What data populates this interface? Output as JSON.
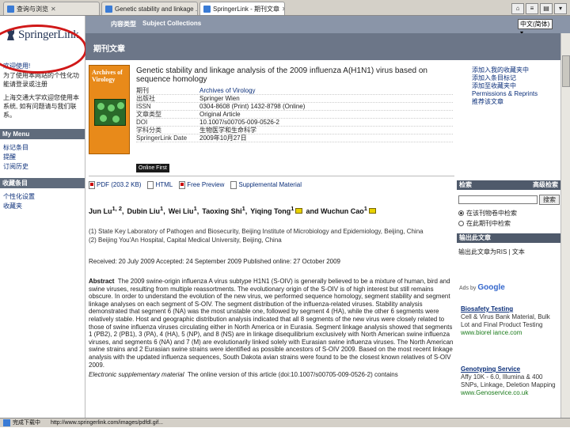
{
  "tabs": [
    {
      "label": "查询与浏览",
      "active": false
    },
    {
      "label": "Genetic stability and linkage ...",
      "active": false
    },
    {
      "label": "SpringerLink - 期刊文章",
      "active": true
    }
  ],
  "logo": {
    "text": "SpringerLink",
    "highlight_color": "#d01818"
  },
  "left": {
    "link1": "欢迎使用!",
    "text1": "为了使用本网站的个性化功能请登录或注册",
    "text2": "上海交通大学欢迎您使用本系统, 如有问题请与我们联系。",
    "my_menu": "My Menu",
    "menu_items": [
      "标记条目",
      "提醒",
      "订阅历史"
    ],
    "collections": "收藏条目",
    "collection_items": [
      "个性化设置",
      "收藏夹"
    ]
  },
  "topbar": {
    "content_label": "内容类型",
    "subject_label": "Subject Collections",
    "language": "中文(简体)"
  },
  "subbar": {
    "title": "期刊文章"
  },
  "cover": {
    "title": "Archives of Virology"
  },
  "article": {
    "title": "Genetic stability and linkage analysis of the 2009 influenza A(H1N1) virus based on sequence homology",
    "meta": [
      {
        "k": "期刊",
        "v": "Archives of Virology",
        "link": true
      },
      {
        "k": "出版社",
        "v": "Springer Wien",
        "link": false
      },
      {
        "k": "ISSN",
        "v": "0304-8608 (Print) 1432-8798 (Online)",
        "link": false
      },
      {
        "k": "文章类型",
        "v": "Original Article",
        "link": false
      },
      {
        "k": "DOI",
        "v": "10.1007/s00705-009-0526-2",
        "link": false
      },
      {
        "k": "学科分类",
        "v": "生物医学和生命科学",
        "link": false
      },
      {
        "k": "SpringerLink Date",
        "v": "2009年10月27日",
        "link": false
      }
    ],
    "online_first": "Online First"
  },
  "right_links": [
    "添加入我的收藏夹中",
    "添加入条目标记",
    "添加至收藏夹中",
    "Permissions & Reprints",
    "推荐该文章"
  ],
  "downloads": [
    "PDF (203.2 KB)",
    "HTML",
    "Free Preview",
    "Supplemental Material"
  ],
  "authors": [
    {
      "name": "Jun Lu",
      "sup": "1, 2",
      "mail": false
    },
    {
      "name": "Dubin Liu",
      "sup": "1",
      "mail": false
    },
    {
      "name": "Wei Liu",
      "sup": "1",
      "mail": false
    },
    {
      "name": "Taoxing Shi",
      "sup": "1",
      "mail": false
    },
    {
      "name": "Yiqing Tong",
      "sup": "1",
      "mail": true
    },
    {
      "name": "and Wuchun Cao",
      "sup": "1",
      "mail": true
    }
  ],
  "affiliations": [
    "(1) State Key Laboratory of Pathogen and Biosecurity, Beijing Institute of Microbiology and Epidemiology, Beijing, China",
    "(2) Beijing You'An Hospital, Capital Medical University, Beijing, China"
  ],
  "dates": "Received: 20 July 2009  Accepted: 24 September 2009  Published online: 27 October 2009",
  "abstract": {
    "label": "Abstract",
    "text": "The 2009 swine-origin influenza A virus subtype H1N1 (S-OIV) is generally believed to be a mixture of human, bird and swine viruses, resulting from multiple reassortments. The evolutionary origin of the S-OIV is of high interest but still remains obscure. In order to understand the evolution of the new virus, we performed sequence homology, segment stability and segment linkage analyses on each segment of S-OIV. The segment distribution of the influenza-related viruses. Stability analysis demonstrated that segment 6 (NA) was the most unstable one, followed by segment 4 (HA), while the other 6 segments were relatively stable. Host and geographic distribution analysis indicated that all 8 segments of the new virus were closely related to those of swine influenza viruses circulating either in North America or in Eurasia. Segment linkage analysis showed that segments 1 (PB2), 2 (PB1), 3 (PA), 4 (HA), 5 (NP), and 8 (NS) are in linkage disequilibrium exclusively with North American swine influenza viruses, and segments 6 (NA) and 7 (M) are evolutionarily linked solely with Eurasian swine influenza viruses. The North American swine strains and 2 Eurasian swine strains were identified as possible ancestors of S-OIV 2009. Based on the most recent linkage analysis with the updated influenza sequences, South Dakota avian strains were found to be the closest known relatives of S-OIV 2009.",
    "esm_label": "Electronic supplementary material",
    "esm_text": "The online version of this article (doi:10.1007/s00705-009-0526-2) contains"
  },
  "sidebar": {
    "search_title": "检索",
    "advanced": "高级检索",
    "search_button": "搜索",
    "radio1": "在该刊物卷中检索",
    "radio2": "在此期刊中检索",
    "export_title": "输出此文章",
    "export_text": "输出此文章为RIS | 文本",
    "ads_by": "Ads by",
    "google": "Google"
  },
  "ads": [
    {
      "title": "Biosafety Testing",
      "body": "Cell & Virus Bank Material, Bulk Lot and Final Product Testing",
      "url": "www.biorel iance.com"
    },
    {
      "title": "Genotyping Service",
      "body": "Affy 10K - 6.0, Illumina & 400 SNPs, Linkage, Deletion Mapping",
      "url": "www.Genoservice.co.uk"
    }
  ],
  "status": {
    "ready": "完成下载中",
    "url": "http://www.springerlink.com/images/pdfdl.gif..."
  }
}
